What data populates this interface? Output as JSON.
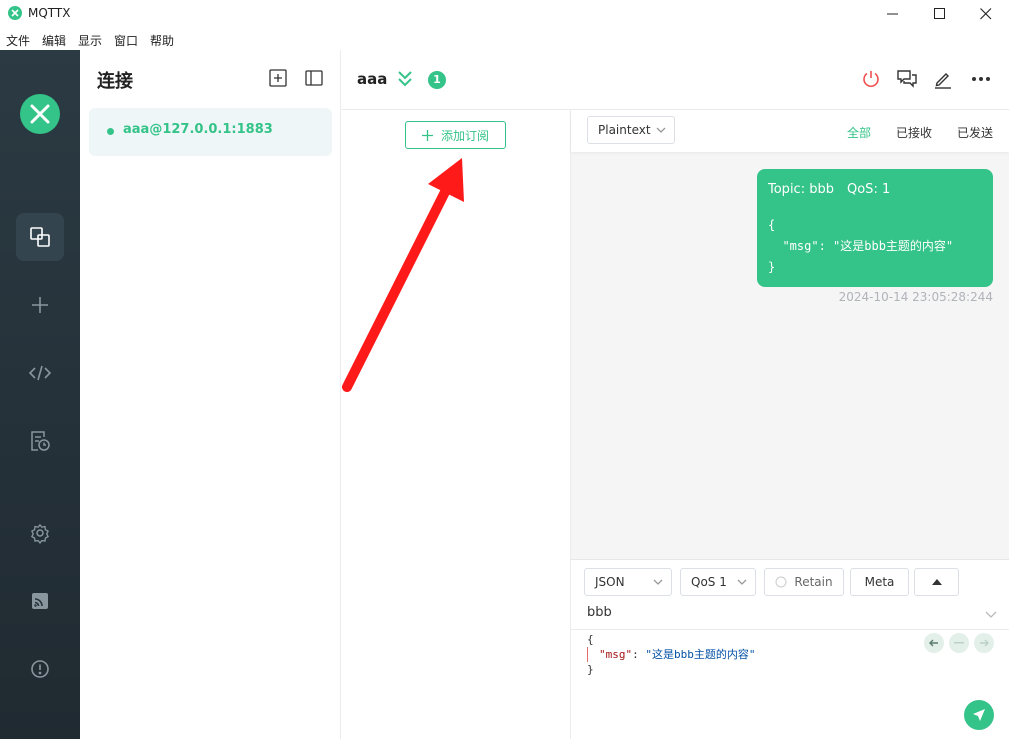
{
  "window": {
    "title": "MQTTX"
  },
  "menu": [
    "文件",
    "编辑",
    "显示",
    "窗口",
    "帮助"
  ],
  "sidebar": {
    "items": [
      {
        "icon": "connections-icon",
        "active": true
      },
      {
        "icon": "plus-icon"
      },
      {
        "icon": "script-icon"
      },
      {
        "icon": "log-icon"
      },
      {
        "icon": "settings-icon"
      },
      {
        "icon": "feed-icon"
      },
      {
        "icon": "about-icon"
      }
    ]
  },
  "connections": {
    "title": "连接",
    "items": [
      {
        "label": "aaa@127.0.0.1:1883",
        "status_color": "#34c388"
      }
    ]
  },
  "header": {
    "name": "aaa",
    "unread_badge": "1"
  },
  "subscriptions": {
    "add_label": "添加订阅"
  },
  "messages": {
    "format": "Plaintext",
    "filters": [
      "全部",
      "已接收",
      "已发送"
    ],
    "active_filter": "全部",
    "list": [
      {
        "topic": "Topic: bbb",
        "qos": "QoS: 1",
        "payload_line1": "{",
        "payload_line2": "  \"msg\": \"这是bbb主题的内容\"",
        "payload_line3": "}",
        "time": "2024-10-14 23:05:28:244"
      }
    ]
  },
  "publish": {
    "format": "JSON",
    "qos": "QoS 1",
    "retain_label": "Retain",
    "meta_label": "Meta",
    "topic": "bbb",
    "code_open": "{",
    "code_key": "\"msg\"",
    "code_colon": ": ",
    "code_value": "\"这是bbb主题的内容\"",
    "code_close": "}"
  },
  "colors": {
    "accent": "#34c388",
    "sidebar": "#2b3a43",
    "annotation": "#ff1a1a"
  }
}
